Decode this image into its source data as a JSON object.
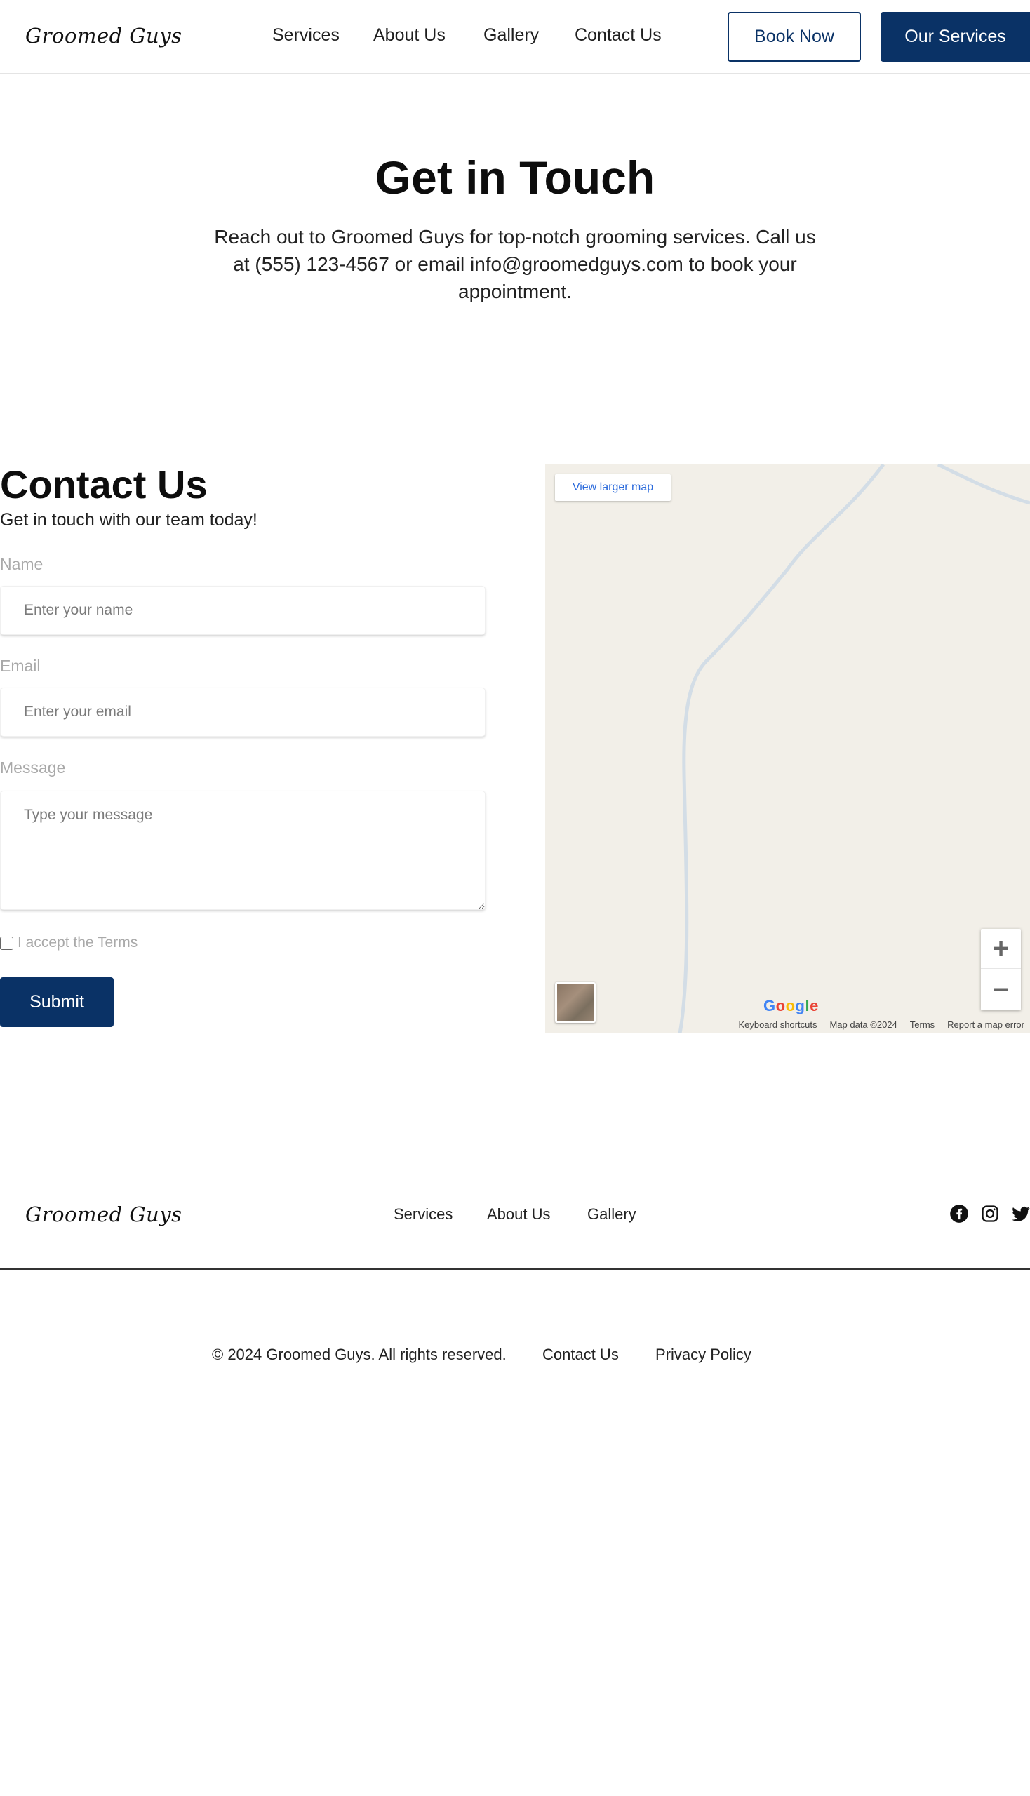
{
  "brand": "Groomed Guys",
  "nav": {
    "items": [
      "Services",
      "About Us",
      "Gallery",
      "Contact Us"
    ],
    "book_label": "Book Now",
    "services_label": "Our Services"
  },
  "hero": {
    "title": "Get in Touch",
    "text": "Reach out to Groomed Guys for top-notch grooming services. Call us at (555) 123-4567 or email info@groomedguys.com to book your appointment."
  },
  "contact": {
    "title": "Contact Us",
    "subtitle": "Get in touch with our team today!",
    "name_label": "Name",
    "name_placeholder": "Enter your name",
    "email_label": "Email",
    "email_placeholder": "Enter your email",
    "message_label": "Message",
    "message_placeholder": "Type your message",
    "terms_label": "I accept the Terms",
    "submit_label": "Submit"
  },
  "map": {
    "view_larger": "View larger map",
    "google": "Google",
    "attribution": [
      "Keyboard shortcuts",
      "Map data ©2024",
      "Terms",
      "Report a map error"
    ],
    "colors": {
      "land": "#f2efe8",
      "road": "#d3dde6"
    }
  },
  "footer": {
    "nav": [
      "Services",
      "About Us",
      "Gallery"
    ],
    "social_icons": [
      "facebook-icon",
      "instagram-icon",
      "twitter-icon"
    ],
    "copyright": "© 2024 Groomed Guys. All rights reserved.",
    "contact_link": "Contact Us",
    "privacy_link": "Privacy Policy"
  },
  "colors": {
    "accent": "#0a3266",
    "muted_label": "#a9a9a9"
  }
}
